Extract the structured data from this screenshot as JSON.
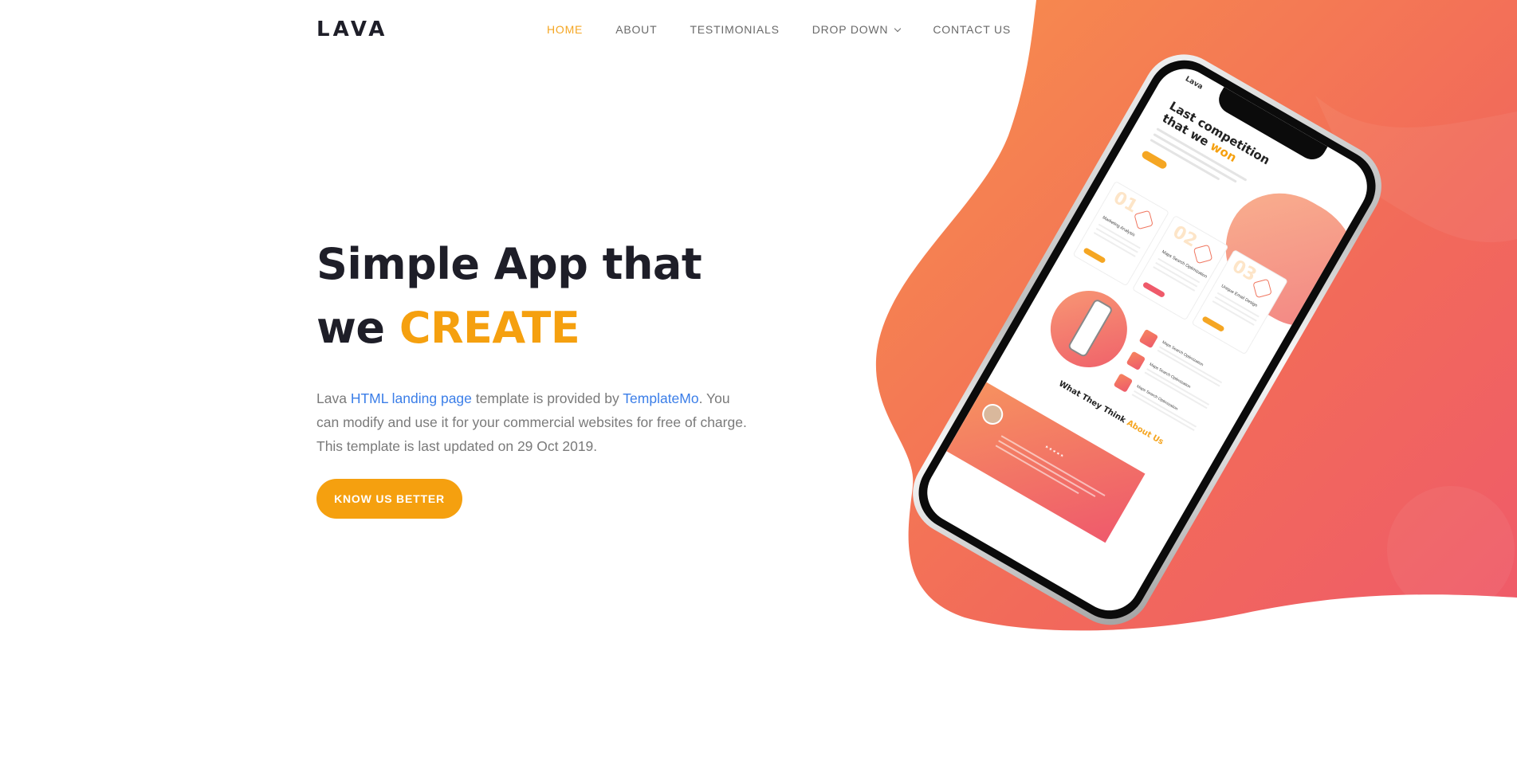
{
  "header": {
    "logo": "LAVA",
    "nav": [
      {
        "label": "HOME",
        "active": true
      },
      {
        "label": "ABOUT",
        "active": false
      },
      {
        "label": "TESTIMONIALS",
        "active": false
      },
      {
        "label": "DROP DOWN",
        "active": false,
        "icon": "chevron-down-icon"
      },
      {
        "label": "CONTACT US",
        "active": false
      }
    ]
  },
  "hero": {
    "title_line1": "Simple App that",
    "title_line2_prefix": "we ",
    "title_line2_accent": "CREATE",
    "text_prefix": "Lava ",
    "text_link1": "HTML landing page",
    "text_middle": " template is provided by ",
    "text_link2": "TemplateMo",
    "text_suffix": ". You can modify and use it for your commercial websites for free of charge. This template is last updated on 29 Oct 2019.",
    "cta_label": "KNOW US BETTER"
  },
  "phone_screen": {
    "brand": "Lava",
    "heading_line1": "Last competition",
    "heading_line2_prefix": "that we ",
    "heading_line2_accent": "won",
    "cards": [
      {
        "num": "01",
        "title": "Marketing Analysis"
      },
      {
        "num": "02",
        "title": "Maps Search Optimization"
      },
      {
        "num": "03",
        "title": "Unique Email Design"
      }
    ],
    "features": [
      "Maps Search Optimization",
      "Maps Search Optimization",
      "Maps Search Optimization"
    ],
    "testimonial_title_prefix": "What They Think ",
    "testimonial_title_accent": "About Us",
    "stars": "★★★★★"
  },
  "colors": {
    "accent": "#f5a00f",
    "link": "#3b7ee8",
    "heading": "#1e1e28",
    "gradient_start": "#f78f4c",
    "gradient_end": "#ef5a6a"
  }
}
